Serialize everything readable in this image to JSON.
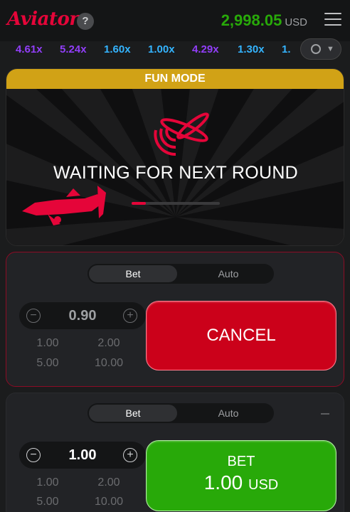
{
  "header": {
    "logo": "Aviator",
    "help_label": "?",
    "balance": "2,998.05",
    "currency": "USD"
  },
  "history": [
    {
      "value": "4.61x",
      "color": "#913ef8"
    },
    {
      "value": "5.24x",
      "color": "#913ef8"
    },
    {
      "value": "1.60x",
      "color": "#34b4ff"
    },
    {
      "value": "1.00x",
      "color": "#34b4ff"
    },
    {
      "value": "4.29x",
      "color": "#913ef8"
    },
    {
      "value": "1.30x",
      "color": "#34b4ff"
    },
    {
      "value": "1.",
      "color": "#34b4ff"
    }
  ],
  "game": {
    "mode_banner": "FUN MODE",
    "status_text": "WAITING FOR NEXT ROUND",
    "progress": 0.16
  },
  "bet_panels": [
    {
      "tabs": [
        "Bet",
        "Auto"
      ],
      "active_tab": "Bet",
      "amount": "0.90",
      "quick_amounts": [
        "1.00",
        "2.00",
        "5.00",
        "10.00"
      ],
      "action_label": "CANCEL",
      "action_color": "#cb011a"
    },
    {
      "tabs": [
        "Bet",
        "Auto"
      ],
      "active_tab": "Bet",
      "amount": "1.00",
      "quick_amounts": [
        "1.00",
        "2.00",
        "5.00",
        "10.00"
      ],
      "action_label": "BET",
      "action_amount": "1.00",
      "action_currency": "USD",
      "action_color": "#28a909"
    }
  ],
  "icons": {
    "menu": "hamburger-menu-icon",
    "history": "clock-history-icon",
    "chevron": "chevron-down-icon",
    "plane": "plane-icon",
    "propeller": "propeller-icon"
  }
}
